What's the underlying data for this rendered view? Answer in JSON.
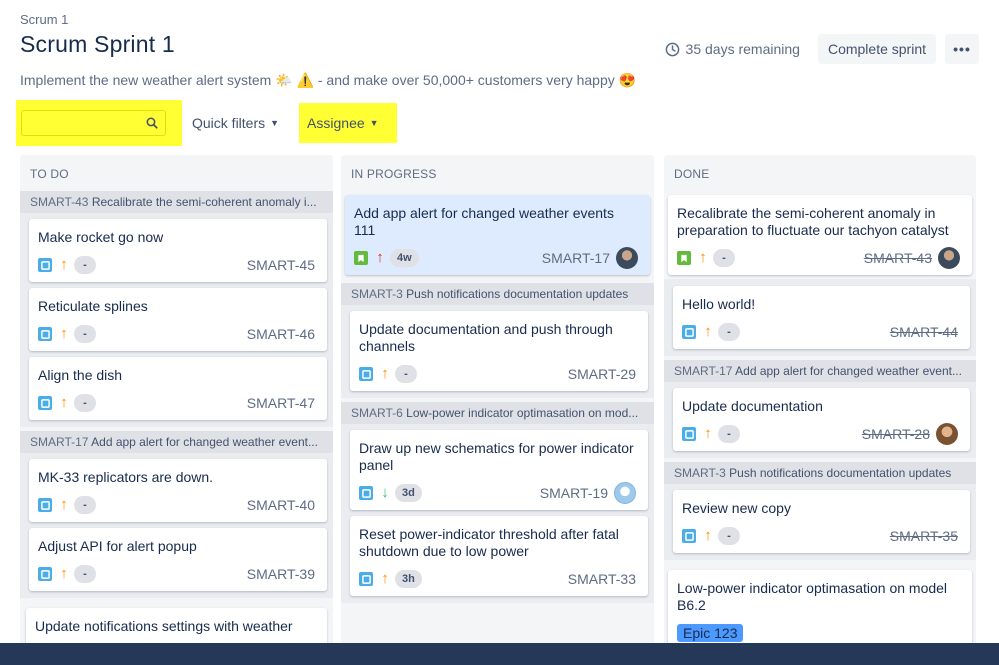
{
  "header": {
    "project": "Scrum 1",
    "title": "Scrum Sprint 1",
    "goal": "Implement the new weather alert system 🌤️ ⚠️  - and make over 50,000+ customers very happy 😍",
    "remaining": "35 days remaining",
    "complete_label": "Complete sprint",
    "more_label": "•••"
  },
  "filters": {
    "search_value": "",
    "quick_filters_label": "Quick filters",
    "assignee_label": "Assignee",
    "chevron": "⌄"
  },
  "colors": {
    "highlight": "#ffff33",
    "task_icon": "#4bade8",
    "story_icon": "#63ba3c",
    "epic": "#4c9aff",
    "selected_card": "#deebff"
  },
  "columns": {
    "todo": {
      "label": "TO DO",
      "groups": [
        {
          "parent_key": "SMART-43",
          "parent_title": "Recalibrate the semi-coherent anomaly i...",
          "cards": [
            {
              "title": "Make rocket go now",
              "type": "task",
              "priority": "high",
              "estimate": "-",
              "key": "SMART-45"
            },
            {
              "title": "Reticulate splines",
              "type": "task",
              "priority": "high",
              "estimate": "-",
              "key": "SMART-46"
            },
            {
              "title": "Align the dish",
              "type": "task",
              "priority": "high",
              "estimate": "-",
              "key": "SMART-47"
            }
          ]
        },
        {
          "parent_key": "SMART-17",
          "parent_title": "Add app alert for changed weather event...",
          "cards": [
            {
              "title": "MK-33 replicators are down.",
              "type": "task",
              "priority": "high",
              "estimate": "-",
              "key": "SMART-40"
            },
            {
              "title": "Adjust API for alert popup",
              "type": "task",
              "priority": "high",
              "estimate": "-",
              "key": "SMART-39"
            }
          ]
        }
      ],
      "loose_card": {
        "title": "Update notifications settings with weather"
      }
    },
    "in_progress": {
      "label": "IN PROGRESS",
      "top_card": {
        "title": "Add app alert for changed weather events 111",
        "type": "story",
        "priority": "highest",
        "estimate": "4w",
        "key": "SMART-17"
      },
      "groups": [
        {
          "parent_key": "SMART-3",
          "parent_title": "Push notifications documentation updates",
          "cards": [
            {
              "title": "Update documentation and push through channels",
              "type": "task",
              "priority": "high",
              "estimate": "-",
              "key": "SMART-29"
            }
          ]
        },
        {
          "parent_key": "SMART-6",
          "parent_title": "Low-power indicator optimasation on mod...",
          "cards": [
            {
              "title": "Draw up new schematics for power indicator panel",
              "type": "task",
              "priority": "low",
              "estimate": "3d",
              "key": "SMART-19"
            },
            {
              "title": "Reset power-indicator threshold after fatal shutdown due to low power",
              "type": "task",
              "priority": "high",
              "estimate": "3h",
              "key": "SMART-33"
            }
          ]
        }
      ]
    },
    "done": {
      "label": "DONE",
      "top_card": {
        "title": "Recalibrate the semi-coherent anomaly in preparation to fluctuate our tachyon catalyst",
        "type": "story",
        "priority": "high",
        "estimate": "-",
        "key": "SMART-43"
      },
      "top_group_cards": [
        {
          "title": "Hello world!",
          "type": "task",
          "priority": "high",
          "estimate": "-",
          "key": "SMART-44"
        }
      ],
      "groups": [
        {
          "parent_key": "SMART-17",
          "parent_title": "Add app alert for changed weather event...",
          "cards": [
            {
              "title": "Update documentation",
              "type": "task",
              "priority": "high",
              "estimate": "-",
              "key": "SMART-28"
            }
          ]
        },
        {
          "parent_key": "SMART-3",
          "parent_title": "Push notifications documentation updates",
          "cards": [
            {
              "title": "Review new copy",
              "type": "task",
              "priority": "high",
              "estimate": "-",
              "key": "SMART-35"
            }
          ]
        }
      ],
      "loose_card": {
        "title": "Low-power indicator optimasation on model B6.2",
        "epic": "Epic 123"
      }
    }
  }
}
